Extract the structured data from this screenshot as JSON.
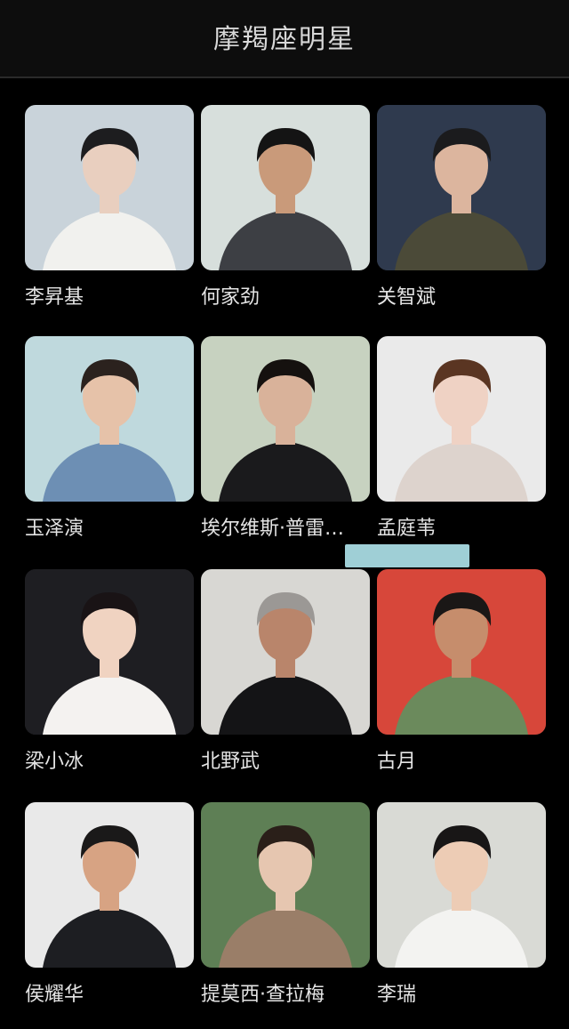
{
  "header": {
    "title": "摩羯座明星"
  },
  "stars": [
    {
      "name": "李昇基",
      "bg": "#c9d3da",
      "skin": "#e9cfbf",
      "hair": "#1d1d1f",
      "shirt": "#f1f1ee"
    },
    {
      "name": "何家劲",
      "bg": "#d7dfdc",
      "skin": "#c99a7a",
      "hair": "#141414",
      "shirt": "#3d3f44"
    },
    {
      "name": "关智斌",
      "bg": "#2f3a4e",
      "skin": "#dcb59e",
      "hair": "#1b1b1d",
      "shirt": "#4b4a38"
    },
    {
      "name": "玉泽演",
      "bg": "#bfd9dd",
      "skin": "#e6c2a9",
      "hair": "#2b221e",
      "shirt": "#6d8fb4"
    },
    {
      "name": "埃尔维斯·普雷斯利",
      "bg": "#c7d2c0",
      "skin": "#d9b29a",
      "hair": "#15110f",
      "shirt": "#1a1a1c"
    },
    {
      "name": "孟庭苇",
      "bg": "#eaeaea",
      "skin": "#efd2c4",
      "hair": "#5a3522",
      "shirt": "#ddd3cd"
    },
    {
      "name": "梁小冰",
      "bg": "#1e1e22",
      "skin": "#f0d3c1",
      "hair": "#191315",
      "shirt": "#f4f2f0"
    },
    {
      "name": "北野武",
      "bg": "#d8d7d3",
      "skin": "#b9856b",
      "hair": "#9b9895",
      "shirt": "#141416"
    },
    {
      "name": "古月",
      "bg": "#d7473a",
      "skin": "#c68d6c",
      "hair": "#1a1716",
      "shirt": "#6b8a5c"
    },
    {
      "name": "侯耀华",
      "bg": "#e9e9e9",
      "skin": "#d7a383",
      "hair": "#1a1919",
      "shirt": "#1d1e22"
    },
    {
      "name": "提莫西·查拉梅",
      "bg": "#5e7f55",
      "skin": "#e6c6b0",
      "hair": "#2a1f19",
      "shirt": "#9a7e68"
    },
    {
      "name": "李瑞",
      "bg": "#d9dad5",
      "skin": "#edccb5",
      "hair": "#181616",
      "shirt": "#f3f3f1"
    }
  ]
}
